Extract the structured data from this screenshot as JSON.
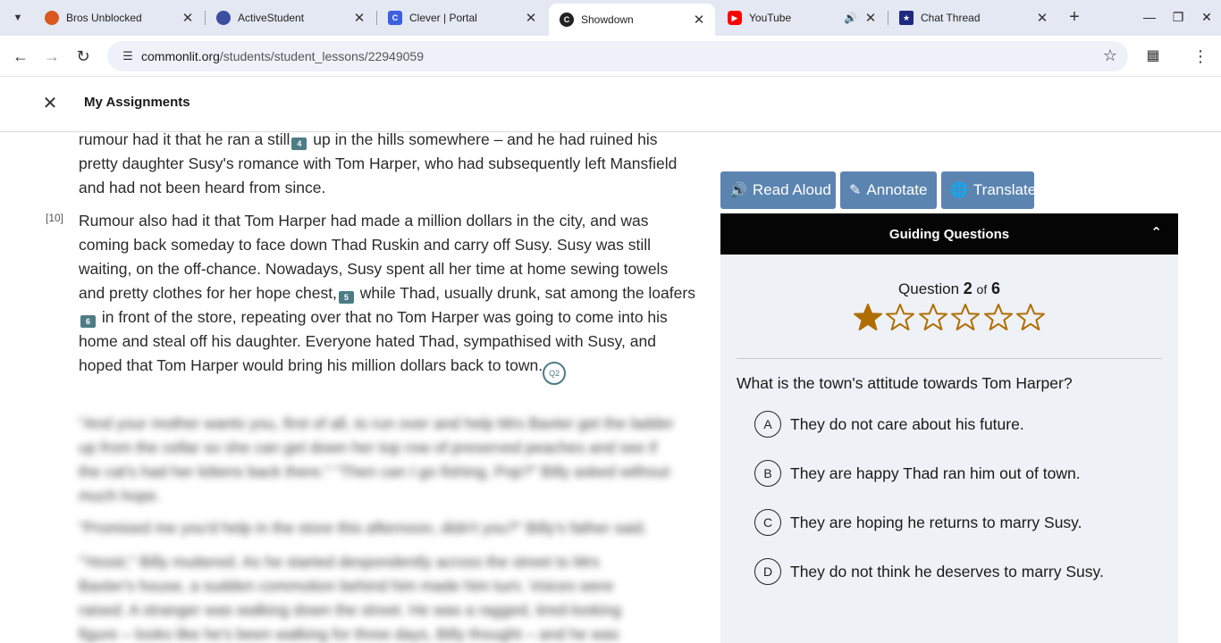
{
  "browser": {
    "tabs": [
      {
        "title": "Bros Unblocked",
        "icon": "basketball-icon",
        "color": "#d9591e"
      },
      {
        "title": "ActiveStudent",
        "icon": "globe-icon",
        "color": "#3b4ea0"
      },
      {
        "title": "Clever | Portal",
        "icon": "clever-icon",
        "color": "#3c5fe0"
      },
      {
        "title": "Showdown",
        "icon": "commonlit-icon",
        "color": "#222222",
        "active": true
      },
      {
        "title": "YouTube",
        "icon": "youtube-icon",
        "color": "#ff0000",
        "audio": true
      },
      {
        "title": "Chat Thread",
        "icon": "badge-icon",
        "color": "#1e2a80"
      }
    ],
    "url_host": "commonlit.org",
    "url_path": "/students/student_lessons/22949059"
  },
  "header": {
    "title": "My Assignments"
  },
  "reader": {
    "p1": {
      "before_fn": "rumour had it that he ran a still",
      "fn": "4",
      "after_fn": " up in the hills somewhere – and he had ruined his pretty daughter Susy's romance with Tom Harper, who had subsequently left Mansfield and had not been heard from since."
    },
    "p2": {
      "number": "[10]",
      "a": "Rumour also had it that Tom Harper had made a million dollars in the city, and was coming back someday to face down Thad Ruskin and carry off Susy. Susy was still waiting, on the off-chance. Nowadays, Susy spent all her time at home sewing towels and pretty clothes for her hope chest,",
      "fn1": "5",
      "b": " while Thad, usually drunk, sat among the loafers",
      "fn2": "6",
      "c": " in front of the store, repeating over that no Tom Harper was going to come into his home and steal off his daughter. Everyone hated Thad, sympathised with Susy, and hoped that Tom Harper would bring his million dollars back to town.",
      "q_badge": "Q2"
    },
    "blur1": "\"And your mother wants you, first of all, to run over and help Mrs Baxter get the ladder up from the cellar so she can get down her top row of preserved peaches and see if the cat's had her kittens back there.\" \"Then can I go fishing, Pop?\" Billy asked without much hope.",
    "blur2": "\"Promised me you'd help in the store this afternoon, didn't you?\" Billy's father said.",
    "blur3": "\"Yessir,\" Billy muttered. As he started despondently across the street to Mrs Baxter's house, a sudden commotion behind him made him turn. Voices were raised. A stranger was walking down the street. He was a ragged, tired-looking figure – looks like he's been walking for three days, Billy thought – and he was"
  },
  "tools": {
    "read_aloud": "Read Aloud",
    "annotate": "Annotate",
    "translate": "Translate"
  },
  "guiding": {
    "title": "Guiding Questions",
    "question_label": "Question",
    "current": "2",
    "of_label": "of",
    "total": "6",
    "stars_filled": 1,
    "stars_total": 6,
    "star_color": "#b06d00",
    "question": "What is the town's attitude towards Tom Harper?",
    "choices": [
      {
        "letter": "A",
        "text": "They do not care about his future."
      },
      {
        "letter": "B",
        "text": "They are happy Thad ran him out of town."
      },
      {
        "letter": "C",
        "text": "They are hoping he returns to marry Susy."
      },
      {
        "letter": "D",
        "text": "They do not think he deserves to marry Susy."
      }
    ]
  }
}
